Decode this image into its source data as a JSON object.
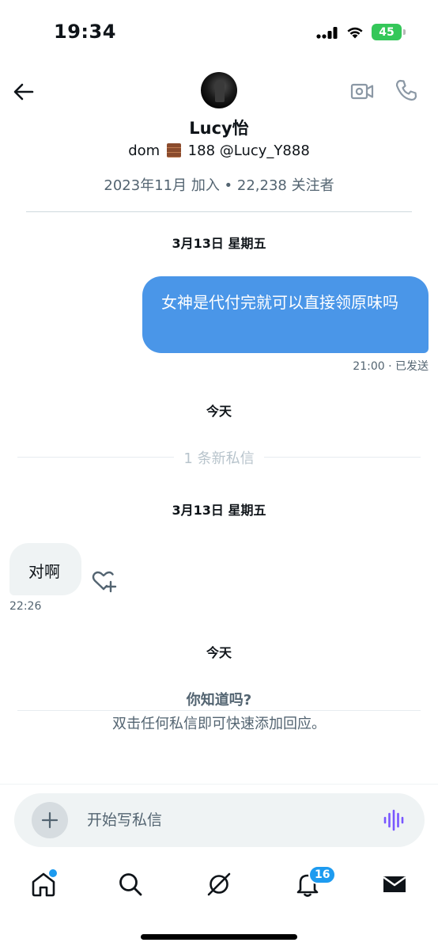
{
  "status_bar": {
    "time": "19:34",
    "battery": "45"
  },
  "header": {
    "display_name": "Lucy怡",
    "bio_prefix": "dom",
    "bio_suffix": "188 @Lucy_Y888",
    "meta": "2023年11月 加入 • 22,238 关注者"
  },
  "conversation": {
    "date_1": "3月13日 星期五",
    "outgoing_text": "女神是代付完就可以直接领原味吗",
    "outgoing_meta": "21:00 · 已发送",
    "today_1": "今天",
    "new_messages_label": "1 条新私信",
    "date_2": "3月13日 星期五",
    "incoming_text": "对啊",
    "incoming_time": "22:26",
    "today_2": "今天",
    "tip_title": "你知道吗?",
    "tip_body": "双击任何私信即可快速添加回应。"
  },
  "composer": {
    "placeholder": "开始写私信"
  },
  "tabbar": {
    "notification_count": "16"
  },
  "colors": {
    "accent": "#1d9bf0",
    "bubble_out": "#4a96e8",
    "bubble_in": "#eff3f4",
    "muted": "#536471"
  }
}
